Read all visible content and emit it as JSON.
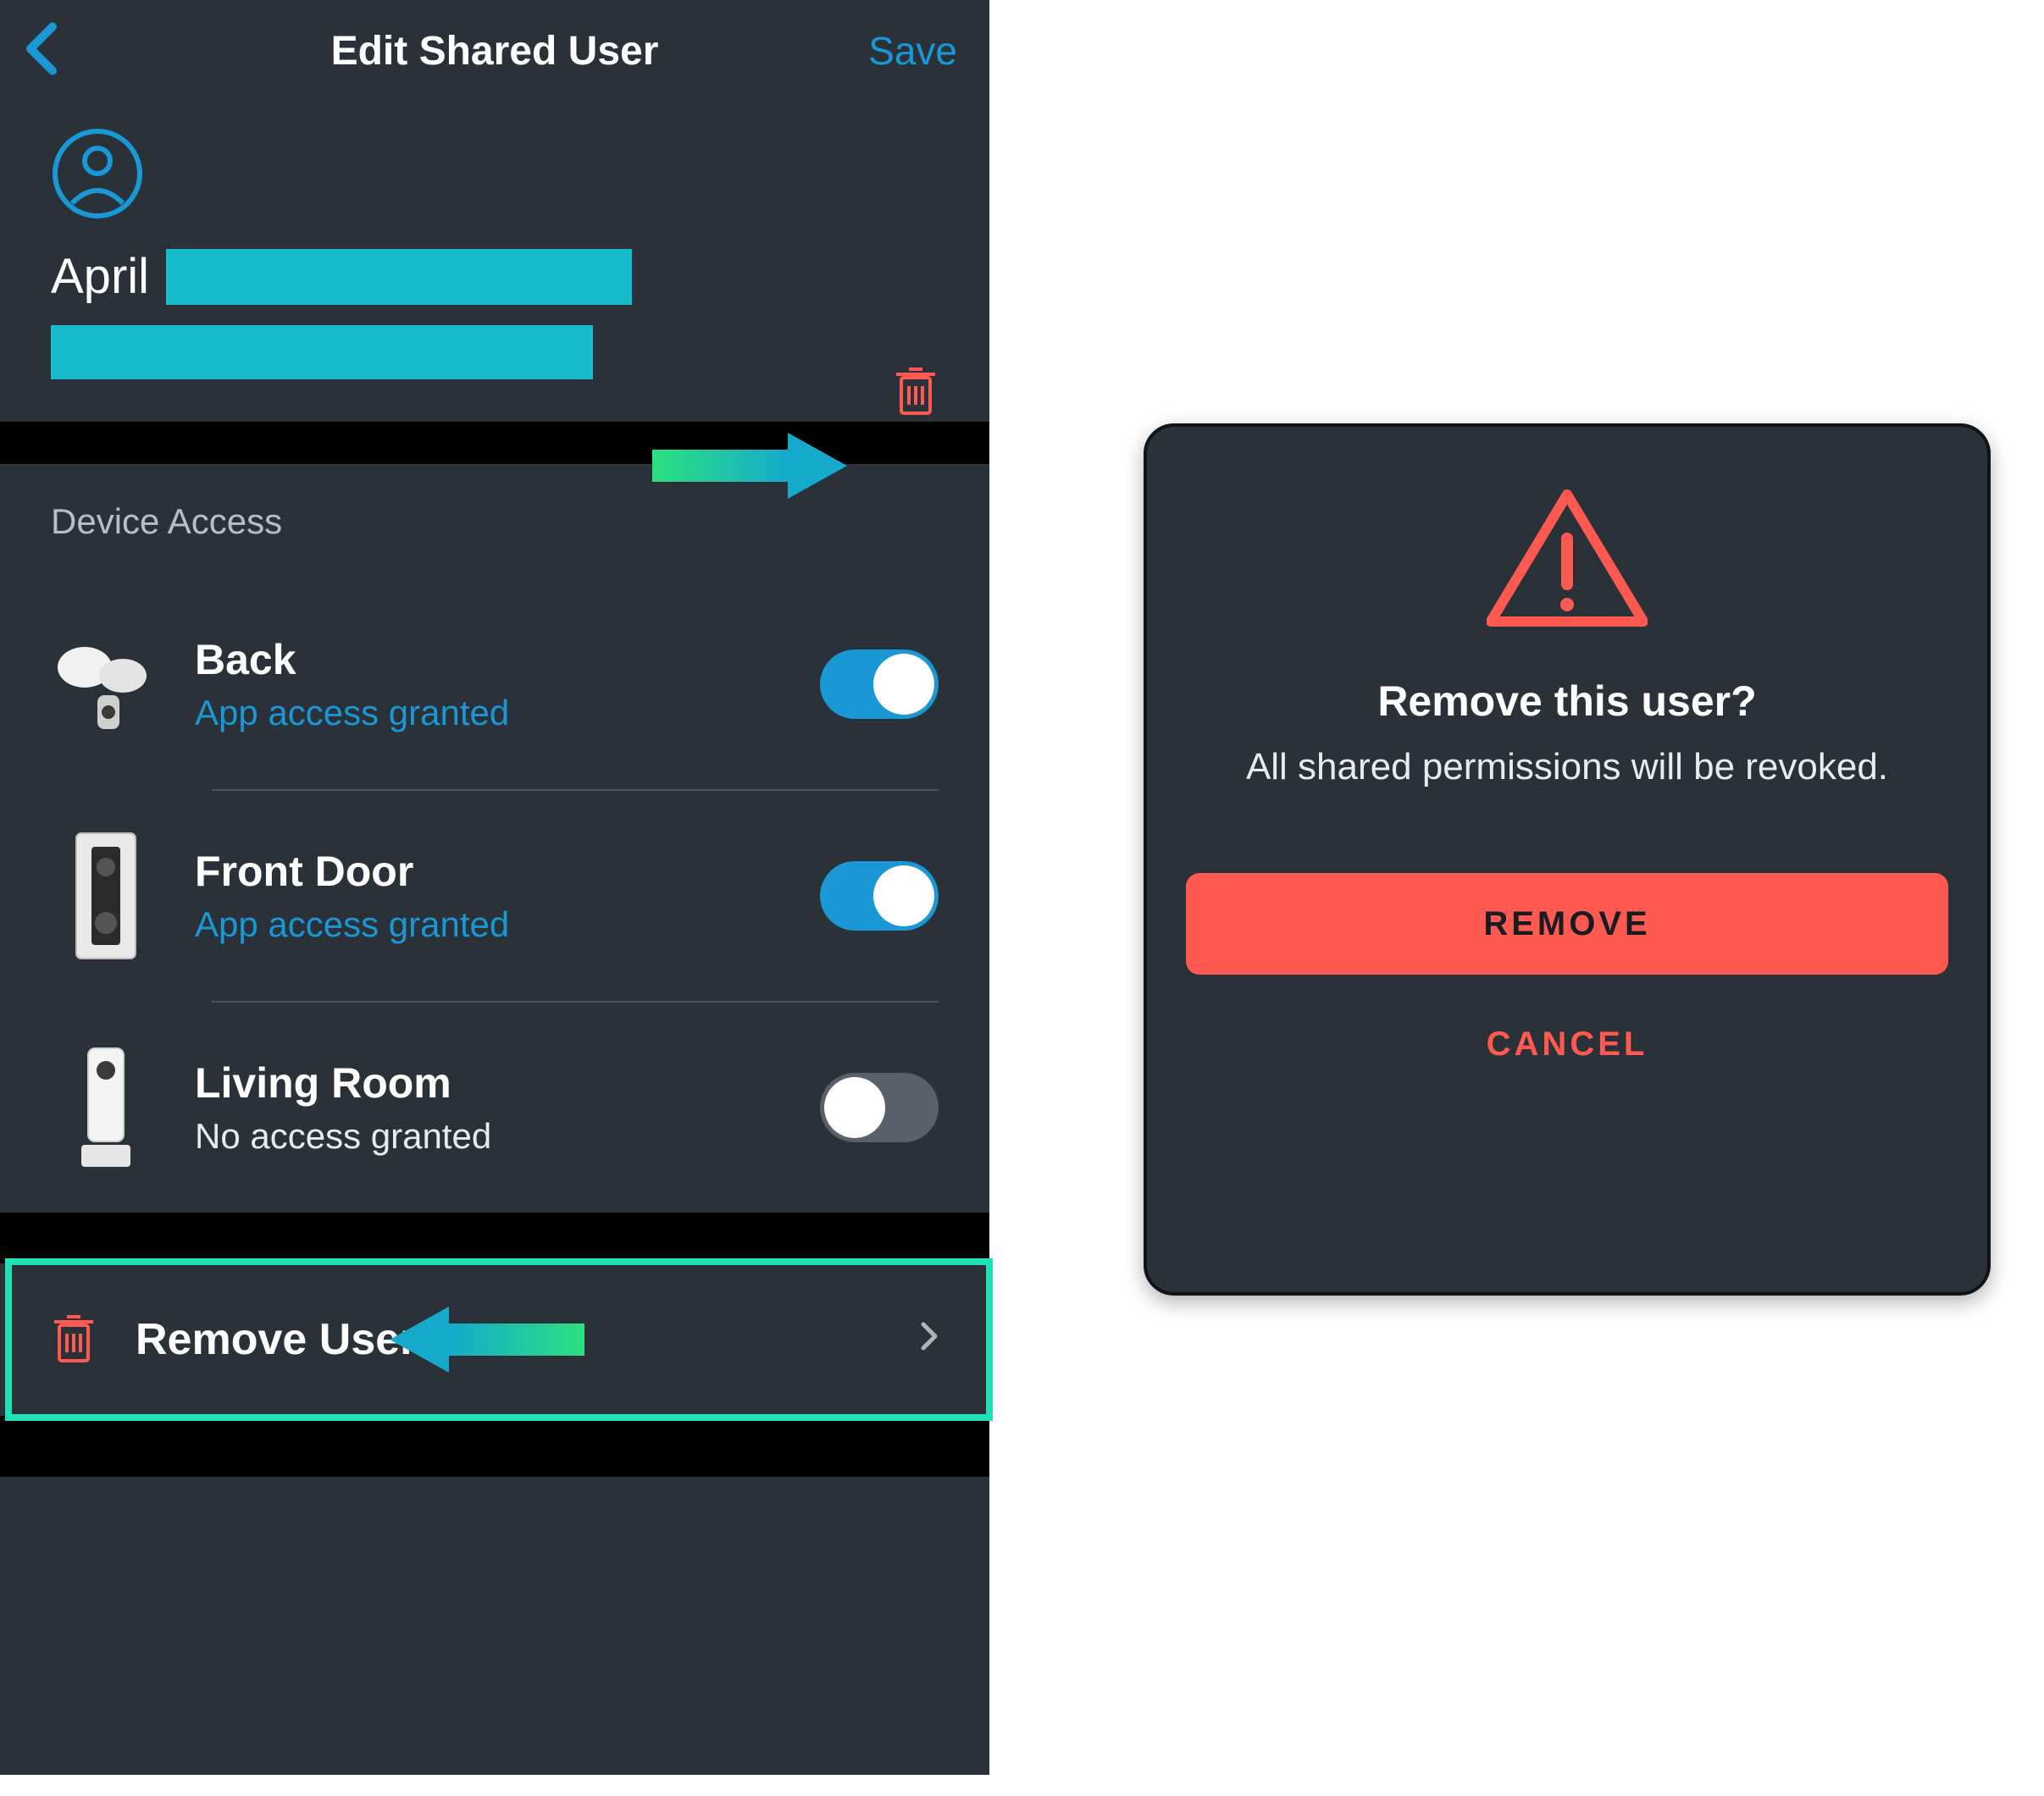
{
  "header": {
    "title": "Edit Shared User",
    "save_label": "Save"
  },
  "user": {
    "first_name": "April"
  },
  "section": {
    "device_access_label": "Device Access"
  },
  "devices": [
    {
      "name": "Back",
      "status": "App access granted",
      "enabled": true
    },
    {
      "name": "Front Door",
      "status": "App access granted",
      "enabled": true
    },
    {
      "name": "Living Room",
      "status": "No access granted",
      "enabled": false
    }
  ],
  "remove_row": {
    "label": "Remove User"
  },
  "dialog": {
    "title": "Remove this user?",
    "subtext": "All shared permissions will be revoked.",
    "remove_label": "REMOVE",
    "cancel_label": "CANCEL"
  },
  "colors": {
    "accent_blue": "#1998d5",
    "accent_teal": "#17bccc",
    "danger_red": "#ff5a52",
    "highlight_green": "#1fe0b6",
    "bg_dark": "#2a3138"
  }
}
